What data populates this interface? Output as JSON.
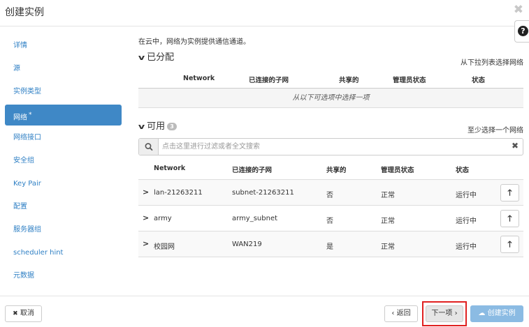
{
  "modal": {
    "title": "创建实例",
    "close_glyph": "✖"
  },
  "help": {
    "glyph": "?"
  },
  "sidebar": {
    "items": [
      {
        "label": "详情"
      },
      {
        "label": "源"
      },
      {
        "label": "实例类型"
      },
      {
        "label": "网络",
        "required_marker": "*"
      },
      {
        "label": "网络接口"
      },
      {
        "label": "安全组"
      },
      {
        "label": "Key Pair"
      },
      {
        "label": "配置"
      },
      {
        "label": "服务器组"
      },
      {
        "label": "scheduler hint"
      },
      {
        "label": "元数据"
      }
    ]
  },
  "main": {
    "description": "在云中，网络为实例提供通信通道。",
    "allocated": {
      "title": "已分配",
      "hint": "从下拉列表选择网络",
      "columns": [
        "Network",
        "已连接的子网",
        "共享的",
        "管理员状态",
        "状态"
      ],
      "empty_text": "从以下可选项中选择一项"
    },
    "available": {
      "title": "可用",
      "count": "3",
      "hint": "至少选择一个网络",
      "search_placeholder": "点击这里进行过滤或者全文搜索",
      "columns": [
        "Network",
        "已连接的子网",
        "共享的",
        "管理员状态",
        "状态"
      ],
      "rows": [
        {
          "network": "lan-21263211",
          "subnet": "subnet-21263211",
          "shared": "否",
          "admin_state": "正常",
          "status": "运行中"
        },
        {
          "network": "army",
          "subnet": "army_subnet",
          "shared": "否",
          "admin_state": "正常",
          "status": "运行中"
        },
        {
          "network": "校园网",
          "subnet": "WAN219",
          "shared": "是",
          "admin_state": "正常",
          "status": "运行中"
        }
      ]
    }
  },
  "footer": {
    "cancel": "取消",
    "back": "返回",
    "next": "下一项",
    "create": "创建实例"
  },
  "colors": {
    "accent": "#3f88c6",
    "link": "#2e7fc4",
    "highlight": "#e02020",
    "create_button": "#8bbbe3"
  }
}
